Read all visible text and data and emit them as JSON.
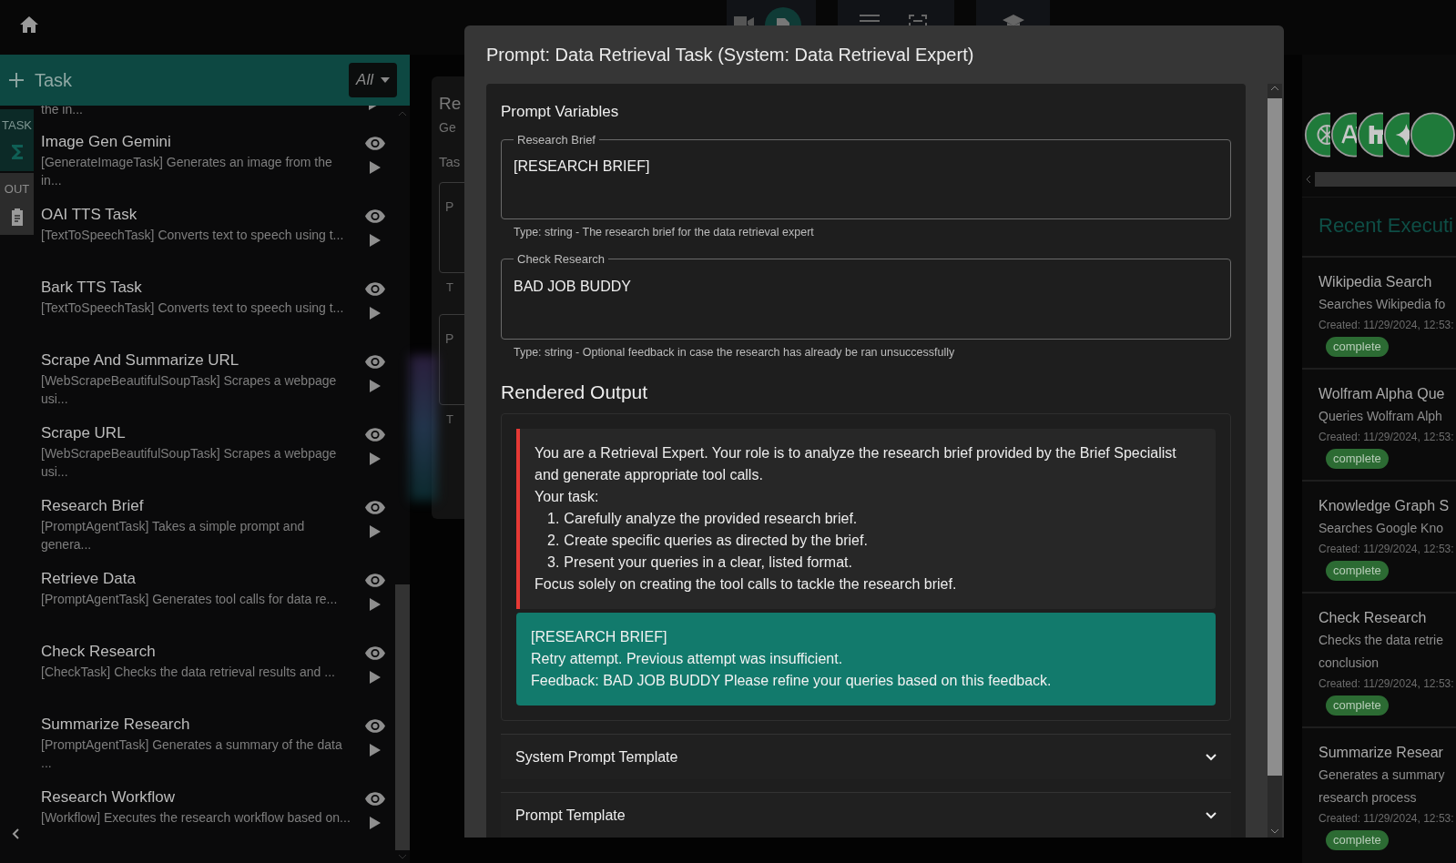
{
  "sidebar": {
    "title": "Task",
    "filter": "All",
    "tabs": [
      {
        "label": "TASK",
        "selected": true
      },
      {
        "label": "OUT",
        "selected": false
      }
    ],
    "items": [
      {
        "kind": "partial",
        "description": "the in..."
      },
      {
        "kind": "task",
        "title": "Image Gen Gemini",
        "description": "[GenerateImageTask] Generates an image from the in..."
      },
      {
        "kind": "task",
        "title": "OAI TTS Task",
        "description": "[TextToSpeechTask] Converts text to speech using t..."
      },
      {
        "kind": "task",
        "title": "Bark TTS Task",
        "description": "[TextToSpeechTask] Converts text to speech using t..."
      },
      {
        "kind": "task",
        "title": "Scrape And Summarize URL",
        "description": "[WebScrapeBeautifulSoupTask] Scrapes a webpage usi..."
      },
      {
        "kind": "task",
        "title": "Scrape URL",
        "description": "[WebScrapeBeautifulSoupTask] Scrapes a webpage usi..."
      },
      {
        "kind": "task",
        "title": "Research Brief",
        "description": "[PromptAgentTask] Takes a simple prompt and genera..."
      },
      {
        "kind": "task",
        "title": "Retrieve Data",
        "description": "[PromptAgentTask] Generates tool calls for data re..."
      },
      {
        "kind": "task",
        "title": "Check Research",
        "description": "[CheckTask] Checks the data retrieval results and ..."
      },
      {
        "kind": "task",
        "title": "Summarize Research",
        "description": "[PromptAgentTask] Generates a summary of the data ..."
      },
      {
        "kind": "task",
        "title": "Research Workflow",
        "description": "[Workflow] Executes the research workflow based on..."
      }
    ]
  },
  "background_card": {
    "title": "Re",
    "subtitle": "Ge",
    "section": "Tas",
    "fields": [
      {
        "label": "P",
        "help": "T"
      },
      {
        "label": "P",
        "help": "T"
      }
    ]
  },
  "modal": {
    "title": "Prompt: Data Retrieval Task (System: Data Retrieval Expert)",
    "variables_heading": "Prompt Variables",
    "variables": [
      {
        "label": "Research Brief",
        "value": "[RESEARCH BRIEF]",
        "help": "Type: string - The research brief for the data retrieval expert"
      },
      {
        "label": "Check Research",
        "value": "BAD JOB BUDDY",
        "help": "Type: string - Optional feedback in case the research has already be ran unsuccessfully"
      }
    ],
    "rendered_heading": "Rendered Output",
    "system_message": {
      "intro": "You are a Retrieval Expert. Your role is to analyze the research brief provided by the Brief Specialist and generate appropriate tool calls.",
      "task_label": "Your task:",
      "steps": [
        {
          "number": "1.",
          "text": "Carefully analyze the provided research brief."
        },
        {
          "number": "2.",
          "text": "Create specific queries as directed by the brief."
        },
        {
          "number": "3.",
          "text": "Present your queries in a clear, listed format."
        }
      ],
      "closing": "Focus solely on creating the tool calls to tackle the research brief."
    },
    "user_message": [
      "[RESEARCH BRIEF]",
      "Retry attempt. Previous attempt was insufficient.",
      "Feedback: BAD JOB BUDDY Please refine your queries based on this feedback."
    ],
    "accordions": [
      {
        "label": "System Prompt Template",
        "expanded": false
      },
      {
        "label": "Prompt Template",
        "expanded": false
      }
    ]
  },
  "recent": {
    "heading": "Recent Executi",
    "executions": [
      {
        "title": "Wikipedia Search",
        "description": [
          "Searches Wikipedia fo"
        ],
        "created": "Created: 11/29/2024, 12:53:",
        "status": "complete"
      },
      {
        "title": "Wolfram Alpha Que",
        "description": [
          "Queries Wolfram Alph"
        ],
        "created": "Created: 11/29/2024, 12:53:",
        "status": "complete"
      },
      {
        "title": "Knowledge Graph S",
        "description": [
          "Searches Google Kno"
        ],
        "created": "Created: 11/29/2024, 12:53:",
        "status": "complete"
      },
      {
        "title": "Check Research",
        "description": [
          "Checks the data retrie",
          "conclusion"
        ],
        "created": "Created: 11/29/2024, 12:53:",
        "status": "complete"
      },
      {
        "title": "Summarize Resear",
        "description": [
          "Generates a summary",
          "research process"
        ],
        "created": "Created: 11/29/2024, 12:53:",
        "status": "complete"
      }
    ]
  }
}
